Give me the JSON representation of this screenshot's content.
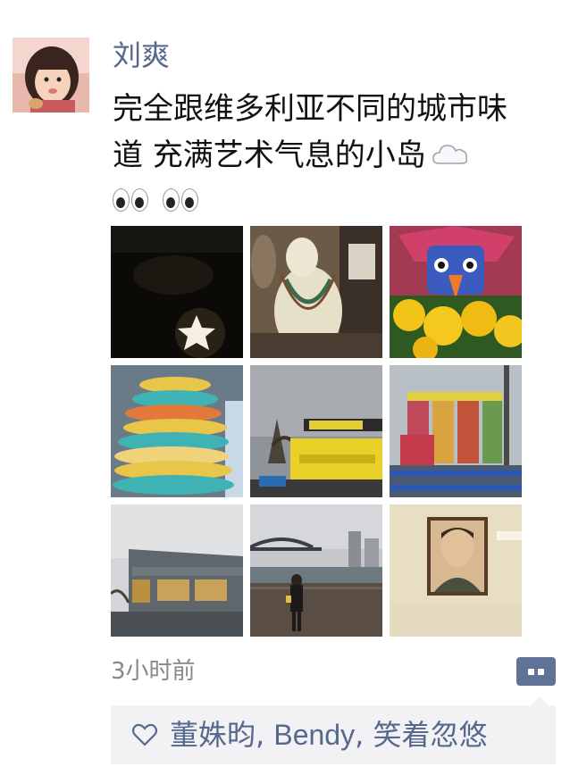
{
  "post": {
    "author": "刘爽",
    "content_line1": "完全跟维多利亚不同的城市味",
    "content_line2": "道 充满艺术气息的小岛",
    "emoji_cloud": "cloud-icon",
    "emoji_eyes": [
      "eyes-icon",
      "eyes-icon"
    ],
    "photos": [
      {
        "name": "photo-star-lamp"
      },
      {
        "name": "photo-jewelry-statue"
      },
      {
        "name": "photo-parrot-flowers"
      },
      {
        "name": "photo-macaron-tower"
      },
      {
        "name": "photo-yellow-building"
      },
      {
        "name": "photo-silo-art"
      },
      {
        "name": "photo-market-building"
      },
      {
        "name": "photo-bridge-waterfront"
      },
      {
        "name": "photo-portrait-painting"
      }
    ],
    "timestamp": "3小时前",
    "likes": {
      "users": [
        "董姝昀",
        "Bendy",
        "笑着忽悠"
      ],
      "sep1": ", ",
      "sep2": ", "
    }
  },
  "colors": {
    "name_blue": "#57688f",
    "comment_button": "#5f7399",
    "likes_bg": "#f2f2f5",
    "timestamp_gray": "#888888"
  }
}
